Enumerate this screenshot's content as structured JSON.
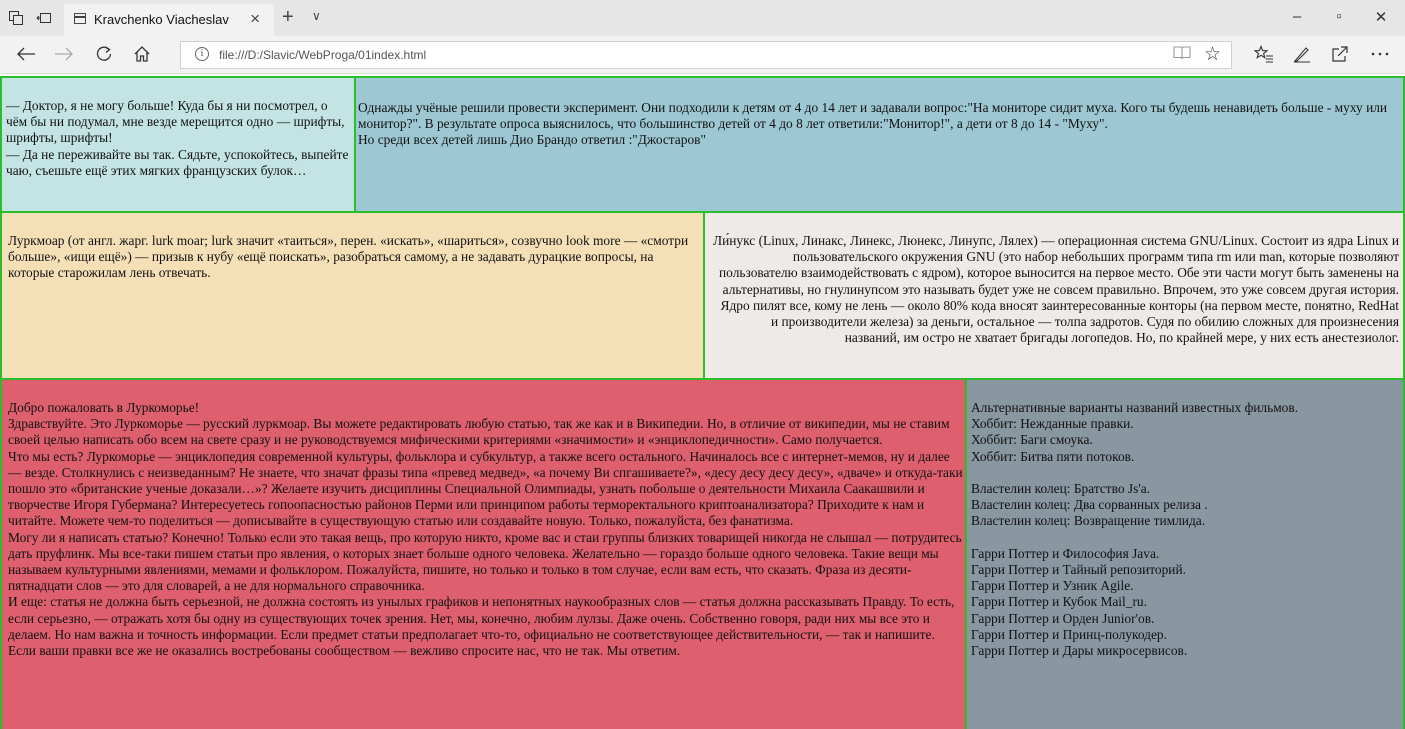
{
  "browser": {
    "tab_title": "Kravchenko Viacheslav",
    "tab_close": "×",
    "new_tab": "+",
    "tab_dropdown": "∨",
    "url": "file:///D:/Slavic/WebProga/01index.html",
    "window_minimize": "–",
    "window_maximize": "▫",
    "window_close": "✕"
  },
  "blocks": {
    "b1": "— Доктор, я не могу больше! Куда бы я ни посмотрел, о чём бы ни подумал, мне везде мерещится одно — шрифты, шрифты, шрифты!\n— Да не переживайте вы так. Сядьте, успокойтесь, выпейте чаю, съешьте ещё этих мягких французских булок…",
    "b2": "Однажды учёные решили провести эксперимент. Они подходили к детям от 4 до 14 лет и задавали вопрос:\"На мониторе сидит муха. Кого ты будешь ненавидеть больше - муху или монитор?\". В результате опроса выяснилось, что большинство детей от 4 до 8 лет ответили:\"Монитор!\", а дети от 8 до 14 - \"Муху\".\nНо среди всех детей лишь Дио Брандо ответил :\"Джостаров\"",
    "b3": "Луркмоар (от англ. жарг. lurk moar; lurk значит «таиться», перен. «искать», «шариться», созвучно look more — «смотри больше», «ищи ещё») — призыв к нубу «ещё поискать», разобраться самому, а не задавать дурацкие вопросы, на которые старожилам лень отвечать.",
    "b4": "Ли́нукс (Linux, Линакс, Линекс, Люнекс, Линупс, Лялех) — операционная система GNU/Linux. Состоит из ядра Linux и пользовательского окружения GNU (это набор небольших программ типа rm или man, которые позволяют пользователю взаимодействовать с ядром), которое выносится на первое место. Обе эти части могут быть заменены на альтернативы, но гнулинупсом это называть будет уже не совсем правильно. Впрочем, это уже совсем другая история. Ядро пилят все, кому не лень — около 80% кода вносят заинтересованные конторы (на первом месте, понятно, RedHat и производители железа) за деньги, остальное — толпа задротов. Судя по обилию сложных для произнесения названий, им остро не хватает бригады логопедов. Но, по крайней мере, у них есть анестезиолог.",
    "b5": "Добро пожаловать в Луркоморье!\nЗдравствуйте. Это Луркоморье — русский луркмоар. Вы можете редактировать любую статью, так же как и в Википедии. Но, в отличие от википедии, мы не ставим своей целью написать обо всем на свете сразу и не руководствуемся мифическими критериями «значимости» и «энциклопедичности». Само получается.\nЧто мы есть? Луркоморье — энциклопедия современной культуры, фольклора и субкультур, а также всего остального. Начиналось все с интернет-мемов, ну и далее — везде. Столкнулись с неизведанным? Не знаете, что значат фразы типа «превед медвед», «а почему Ви спгашиваете?», «десу десу десу десу», «дваче» и откуда-таки пошло это «британские ученые доказали…»? Желаете изучить дисциплины Специальной Олимпиады, узнать побольше о деятельности Михаила Саакашвили и творчестве Игоря Губермана? Интересуетесь гопоопасностью районов Перми или принципом работы терморектального криптоанализатора? Приходите к нам и читайте. Можете чем-то поделиться — дописывайте в существующую статью или создавайте новую. Только, пожалуйста, без фанатизма.\nМогу ли я написать статью? Конечно! Только если это такая вещь, про которую никто, кроме вас и стаи группы близких товарищей никогда не слышал — потрудитесь дать пруфлинк. Мы все-таки пишем статьи про явления, о которых знает больше одного человека. Желательно — гораздо больше одного человека. Такие вещи мы называем культурными явлениями, мемами и фольклором. Пожалуйста, пишите, но только и только в том случае, если вам есть, что сказать. Фраза из десяти-пятнадцати слов — это для словарей, а не для нормального справочника.\nИ еще: статья не должна быть серьезной, не должна состоять из унылых графиков и непонятных наукообразных слов — статья должна рассказывать Правду. То есть, если серьезно, — отражать хотя бы одну из существующих точек зрения. Нет, мы, конечно, любим лулзы. Даже очень. Собственно говоря, ради них мы все это и делаем. Но нам важна и точность информации. Если предмет статьи предполагает что-то, официально не соответствующее действительности, — так и напишите. Если ваши правки все же не оказались востребованы сообществом — вежливо спросите нас, что не так. Мы ответим.",
    "b6": "Альтернативные варианты названий известных фильмов.\nХоббит: Нежданные правки.\nХоббит: Баги смоука.\nХоббит: Битва пяти потоков.\n\nВластелин колец: Братство Js'а.\nВластелин колец: Два сорванных релиза .\nВластелин колец: Возвращение тимлида.\n\nГарри Поттер и Философия Java.\nГарри Поттер и Тайный репозиторий.\nГарри Поттер и Узник Agile.\nГарри Поттер и Кубок Mail_ru.\nГарри Поттер и Орден Junior'ов.\nГарри Поттер и Принц-полукодер.\nГарри Поттер и Дары микросервисов."
  },
  "colors": {
    "block_border": "#2bbd2b",
    "b1": "#c4e4e4",
    "b2": "#9dc8d3",
    "b3": "#f5dfb7",
    "b4": "#eeeae7",
    "b5": "#de5f6e",
    "b6": "#8997a1"
  },
  "icons": [
    "tab-actions-icon",
    "tab-aside-icon",
    "page-icon",
    "back-icon",
    "forward-icon",
    "refresh-icon",
    "home-icon",
    "info-icon",
    "reading-view-icon",
    "favorite-star-icon",
    "favorites-hub-icon",
    "pen-icon",
    "share-icon",
    "more-icon"
  ]
}
